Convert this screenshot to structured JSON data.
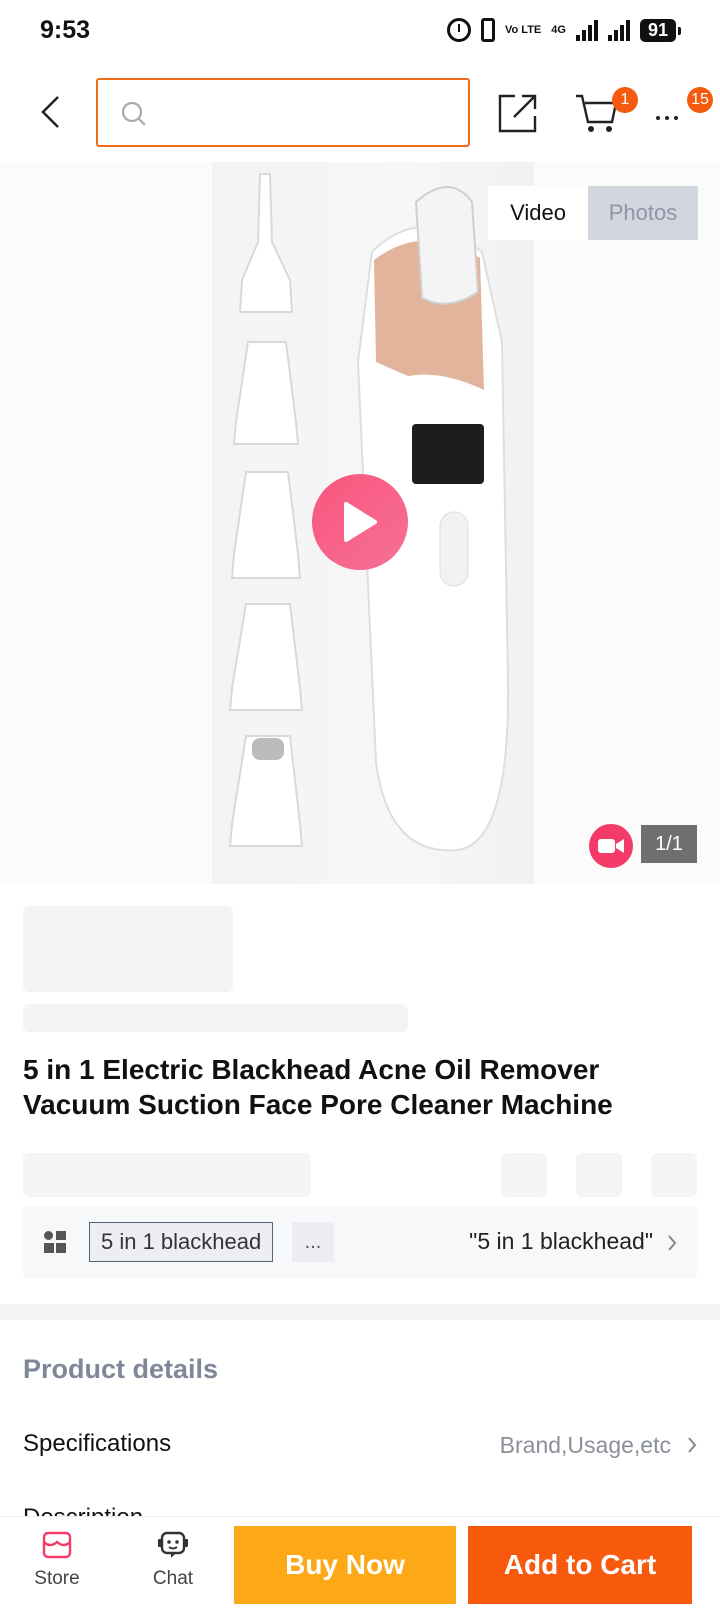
{
  "status_bar": {
    "time": "9:53",
    "volte": "Vo LTE",
    "network": "4G",
    "battery": "91",
    "icons": [
      "alarm-icon",
      "vibrate-icon",
      "volte-icon",
      "signal-icon",
      "battery-icon"
    ]
  },
  "header": {
    "search": {
      "value": "",
      "placeholder": ""
    },
    "cart_badge": "1",
    "more_badge": "15",
    "icons": [
      "back-icon",
      "search-icon",
      "share-icon",
      "cart-icon",
      "more-icon"
    ]
  },
  "gallery": {
    "tabs": {
      "video": "Video",
      "photos": "Photos"
    },
    "active_tab": "Video",
    "page_indicator": "1/1",
    "icons": [
      "play-icon",
      "video-camera-icon"
    ]
  },
  "product": {
    "title": "5 in 1 Electric Blackhead Acne Oil Remover Vacuum Suction Face Pore Cleaner Machine"
  },
  "variant": {
    "chip": "5 in 1 blackhead",
    "more": "...",
    "selected": "\"5 in 1 blackhead\""
  },
  "details": {
    "section_title": "Product details",
    "specifications_label": "Specifications",
    "specifications_value": "Brand,Usage,etc",
    "description_label": "Description"
  },
  "bottom_bar": {
    "store_label": "Store",
    "chat_label": "Chat",
    "buy_now": "Buy Now",
    "add_to_cart": "Add to Cart"
  },
  "colors": {
    "accent_orange": "#f85a0d",
    "buy_now_yellow": "#fca817",
    "play_pink": "#f9567d",
    "search_border": "#ef6c1d",
    "section_title_gray": "#7f8799"
  }
}
